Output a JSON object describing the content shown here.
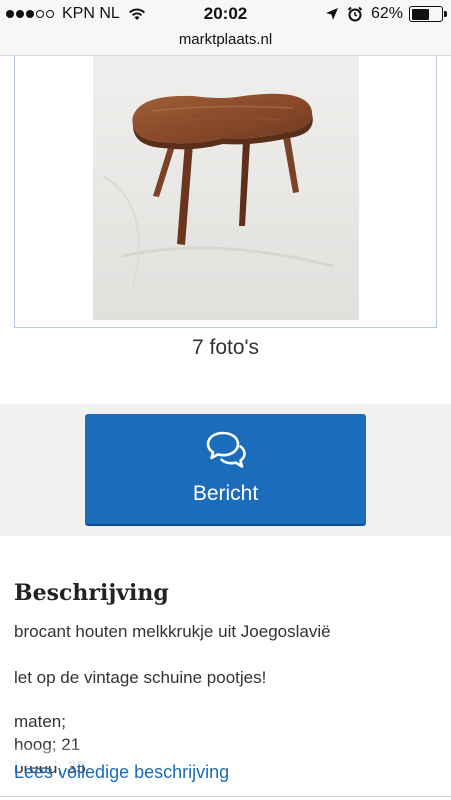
{
  "status_bar": {
    "carrier": "KPN NL",
    "time": "20:02",
    "battery_percent": "62%",
    "battery_level": 0.62,
    "signal_bars_filled": 3,
    "signal_bars_total": 5
  },
  "browser": {
    "url": "marktplaats.nl"
  },
  "listing": {
    "photo_count_label": "7 foto's",
    "message_button_label": "Bericht",
    "description_title": "Beschrijving",
    "description_lines": [
      "brocant houten melkkrukje uit Joegoslavië",
      "let op de vintage schuine pootjes!",
      "maten;",
      "hoog; 21",
      "breed; 35"
    ],
    "read_more_label": "Lees volledige beschrijving"
  },
  "colors": {
    "primary_blue": "#1b6cba",
    "band_background": "#f1f1f0"
  },
  "icons": [
    "wifi-icon",
    "location-arrow-icon",
    "alarm-icon",
    "battery-icon",
    "chat-bubbles-icon"
  ]
}
